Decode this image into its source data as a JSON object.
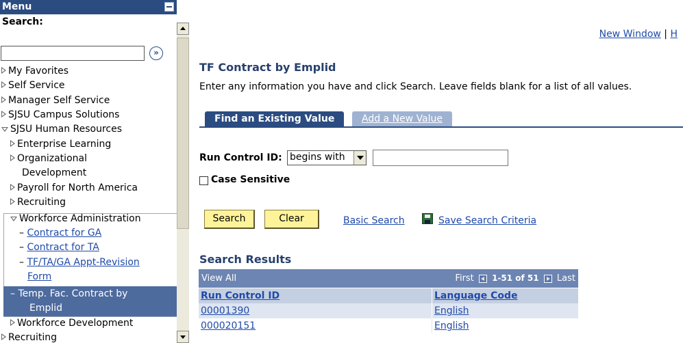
{
  "menu": {
    "title": "Menu",
    "search_label": "Search:",
    "search_value": "",
    "go_icon": "»",
    "items": [
      {
        "label": "My Favorites"
      },
      {
        "label": "Self Service"
      },
      {
        "label": "Manager Self Service"
      },
      {
        "label": "SJSU Campus Solutions"
      },
      {
        "label": "SJSU Human Resources"
      },
      {
        "label": "Enterprise Learning"
      },
      {
        "label": "Organizational"
      },
      {
        "label": "Development"
      },
      {
        "label": "Payroll for North America"
      },
      {
        "label": "Recruiting"
      },
      {
        "label": "Workforce Administration"
      },
      {
        "label": "Contract for GA"
      },
      {
        "label": "Contract for TA"
      },
      {
        "label": "TF/TA/GA Appt-Revision"
      },
      {
        "label": "Form"
      },
      {
        "label": "Temp. Fac. Contract by"
      },
      {
        "label": "Emplid"
      },
      {
        "label": "Workforce Development"
      },
      {
        "label": "Recruiting"
      }
    ]
  },
  "header_links": {
    "new_window": "New Window",
    "separator": "|",
    "help": "H"
  },
  "page": {
    "title": "TF Contract by Emplid",
    "instructions": "Enter any information you have and click Search. Leave fields blank for a list of all values."
  },
  "tabs": {
    "find": "Find an Existing Value",
    "add": "Add a New Value"
  },
  "form": {
    "run_control_label": "Run Control ID:",
    "operator": "begins with",
    "run_control_value": "",
    "case_sensitive_label": "Case Sensitive",
    "search_button": "Search",
    "clear_button": "Clear",
    "basic_search": "Basic Search",
    "save_search": "Save Search Criteria"
  },
  "results": {
    "title": "Search Results",
    "view_all": "View All",
    "first": "First",
    "range": "1-51 of 51",
    "last": "Last",
    "columns": [
      "Run Control ID",
      "Language Code"
    ],
    "rows": [
      [
        "00001390",
        "English"
      ],
      [
        "000020151",
        "English"
      ]
    ]
  },
  "colors": {
    "header_blue": "#2b4c81",
    "selected_row": "#4e6b9e",
    "button_yellow": "#fff39a",
    "link": "#1f4aa8"
  }
}
